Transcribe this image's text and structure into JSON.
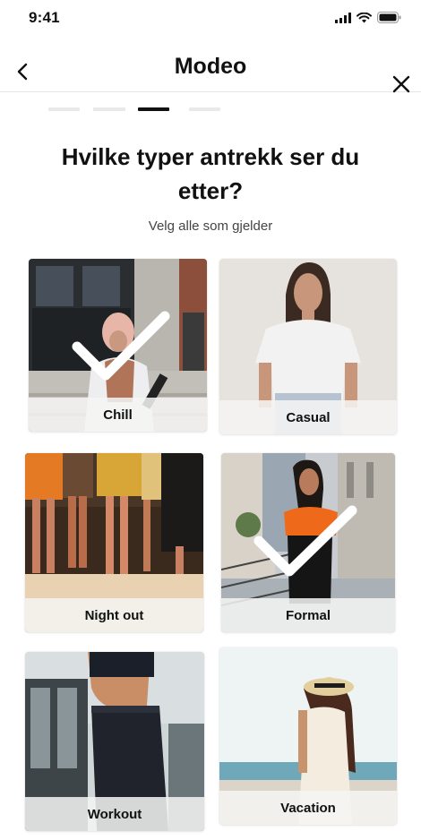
{
  "status_bar": {
    "time": "9:41"
  },
  "header": {
    "title": "Modeo"
  },
  "progress": {
    "total_steps": 4,
    "current_step": 3
  },
  "question": {
    "title": "Hvilke typer antrekk ser du etter?",
    "subtitle": "Velg alle som gjelder"
  },
  "options": [
    {
      "label": "Chill",
      "selected": true
    },
    {
      "label": "Casual",
      "selected": false
    },
    {
      "label": "Night out",
      "selected": false
    },
    {
      "label": "Formal",
      "selected": true
    },
    {
      "label": "Workout",
      "selected": false
    },
    {
      "label": "Vacation",
      "selected": false
    }
  ],
  "icons": {
    "back": "chevron-left-icon",
    "close": "close-icon",
    "check": "checkmark-icon"
  },
  "colors": {
    "accent": "#111111",
    "inactive_segment": "#e9e9e9",
    "label_overlay": "#f5f4f3"
  }
}
